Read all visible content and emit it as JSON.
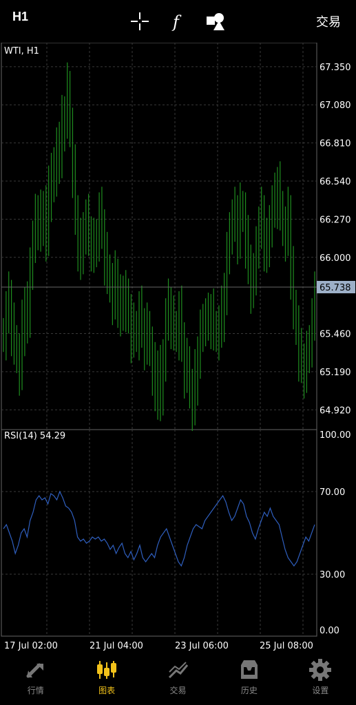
{
  "header": {
    "timeframe": "H1",
    "trade_label": "交易",
    "icons": [
      "crosshair-icon",
      "function-icon",
      "objects-icon"
    ]
  },
  "chart": {
    "symbol_label": "WTI, H1",
    "price_ticks": [
      "67.350",
      "67.080",
      "66.810",
      "66.540",
      "66.270",
      "66.000",
      "65.460",
      "65.190",
      "64.920"
    ],
    "current_price": "65.738",
    "rsi_label": "RSI(14) 54.29",
    "rsi_ticks": [
      "100.00",
      "70.00",
      "30.00",
      "0.00"
    ],
    "time_labels": [
      "17 Jul 02:00",
      "21 Jul 04:00",
      "23 Jul 06:00",
      "25 Jul 08:00"
    ],
    "colors": {
      "bull": "#1f8f1f",
      "rsi": "#2f5fbf",
      "grid": "#3a3a3a",
      "price_badge": "#9db0c8"
    }
  },
  "chart_data": [
    {
      "type": "bar",
      "title": "WTI, H1",
      "xlabel": "",
      "ylabel": "",
      "ylim": [
        64.78,
        67.52
      ],
      "categories": [
        "17 Jul 02:00",
        "21 Jul 04:00",
        "23 Jul 06:00",
        "25 Jul 08:00"
      ],
      "close_points": [
        65.45,
        65.6,
        65.7,
        65.5,
        65.4,
        65.3,
        65.2,
        65.5,
        65.65,
        65.55,
        65.95,
        66.1,
        66.25,
        66.3,
        66.2,
        66.35,
        66.15,
        66.45,
        66.6,
        66.55,
        66.8,
        66.7,
        66.95,
        67.0,
        67.2,
        66.9,
        66.6,
        66.3,
        66.1,
        66.0,
        66.2,
        66.25,
        66.15,
        66.1,
        66.05,
        66.15,
        66.3,
        66.2,
        66.0,
        65.9,
        65.8,
        65.7,
        65.85,
        65.7,
        65.6,
        65.75,
        65.65,
        65.6,
        65.45,
        65.5,
        65.45,
        65.6,
        65.5,
        65.4,
        65.5,
        65.35,
        65.2,
        65.05,
        65.2,
        65.0,
        65.3,
        65.55,
        65.65,
        65.55,
        65.5,
        65.45,
        65.6,
        65.4,
        65.2,
        65.25,
        65.05,
        64.95,
        65.15,
        65.3,
        65.45,
        65.55,
        65.55,
        65.55,
        65.6,
        65.5,
        65.45,
        65.5,
        65.6,
        65.75,
        66.0,
        66.2,
        66.25,
        66.3,
        66.15,
        66.35,
        66.3,
        66.1,
        65.95,
        65.8,
        65.85,
        66.1,
        66.2,
        66.3,
        66.1,
        66.05,
        66.25,
        66.35,
        66.4,
        66.5,
        66.35,
        66.2,
        66.15,
        66.3,
        65.9,
        65.65,
        65.5,
        65.3,
        65.25,
        65.2,
        65.3,
        65.4,
        65.55,
        65.7
      ]
    },
    {
      "type": "line",
      "title": "RSI(14) 54.29",
      "ylim": [
        0,
        100
      ],
      "series": [
        {
          "values": [
            52,
            54,
            50,
            46,
            40,
            44,
            50,
            52,
            48,
            56,
            60,
            66,
            68,
            66,
            67,
            64,
            69,
            68,
            66,
            70,
            67,
            63,
            62,
            60,
            56,
            48,
            46,
            47,
            45,
            46,
            48,
            47,
            48,
            46,
            47,
            45,
            42,
            44,
            40,
            43,
            45,
            40,
            38,
            41,
            37,
            40,
            44,
            38,
            36,
            38,
            40,
            38,
            44,
            48,
            50,
            52,
            48,
            44,
            40,
            36,
            34,
            38,
            44,
            48,
            52,
            54,
            53,
            52,
            56,
            58,
            60,
            62,
            64,
            66,
            68,
            65,
            60,
            56,
            58,
            62,
            66,
            64,
            58,
            55,
            50,
            47,
            52,
            56,
            60,
            58,
            62,
            58,
            56,
            54,
            48,
            42,
            38,
            36,
            34,
            36,
            40,
            44,
            48,
            46,
            50,
            54
          ]
        }
      ]
    }
  ],
  "nav": {
    "items": [
      {
        "label": "行情",
        "icon": "quotes-icon"
      },
      {
        "label": "图表",
        "icon": "chart-icon"
      },
      {
        "label": "交易",
        "icon": "trade-icon"
      },
      {
        "label": "历史",
        "icon": "history-icon"
      },
      {
        "label": "设置",
        "icon": "settings-icon"
      }
    ],
    "active_index": 1
  }
}
